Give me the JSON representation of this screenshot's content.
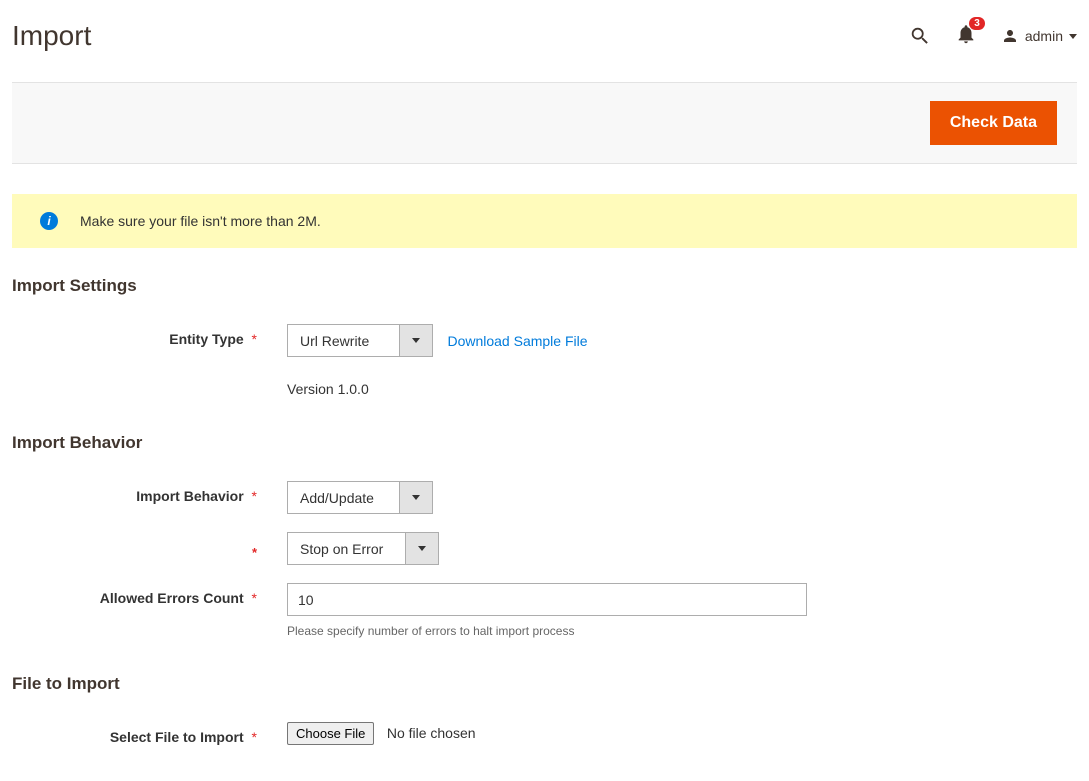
{
  "header": {
    "title": "Import",
    "notification_count": "3",
    "username": "admin"
  },
  "action_bar": {
    "primary_button": "Check Data"
  },
  "notice": {
    "message": "Make sure your file isn't more than 2M."
  },
  "sections": {
    "import_settings": {
      "title": "Import Settings",
      "entity_type": {
        "label": "Entity Type",
        "value": "Url Rewrite",
        "sample_link": "Download Sample File",
        "version": "Version 1.0.0"
      }
    },
    "import_behavior": {
      "title": "Import Behavior",
      "behavior": {
        "label": "Import Behavior",
        "value": "Add/Update"
      },
      "validation": {
        "value": "Stop on Error"
      },
      "allowed_errors": {
        "label": "Allowed Errors Count",
        "value": "10",
        "help": "Please specify number of errors to halt import process"
      }
    },
    "file_to_import": {
      "title": "File to Import",
      "select_file": {
        "label": "Select File to Import",
        "button": "Choose File",
        "status": "No file chosen"
      }
    }
  }
}
